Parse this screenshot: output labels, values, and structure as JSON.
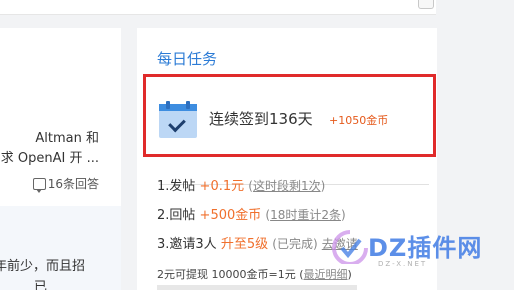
{
  "left_feed": {
    "lines": [
      "Altman 和",
      "求 OpenAI 开 ...",
      "年前少，而且招",
      "已"
    ],
    "reply_count": "16条回答"
  },
  "daily_tasks": {
    "title": "每日任务",
    "signin": {
      "text": "连续签到136天",
      "reward": "+1050金币"
    },
    "tasks": [
      {
        "label": "1.发帖",
        "reward": "+0.1元",
        "hint": "这时段剩1次"
      },
      {
        "label": "2.回帖",
        "reward": "+500金币",
        "hint": "18时重计2条"
      },
      {
        "label": "3.邀请3人",
        "reward": "升至5级",
        "hint": "已完成",
        "extra": "去邀请"
      }
    ],
    "footnote": "2元可提现 10000金币=1元",
    "footnote_link": "最近明细"
  },
  "watermark": {
    "text": "DZ插件网",
    "url": "DZ-X.NET"
  },
  "colors": {
    "accent_blue": "#2d7cd6",
    "highlight_red": "#e02a2a",
    "reward_orange": "#f0702d"
  }
}
